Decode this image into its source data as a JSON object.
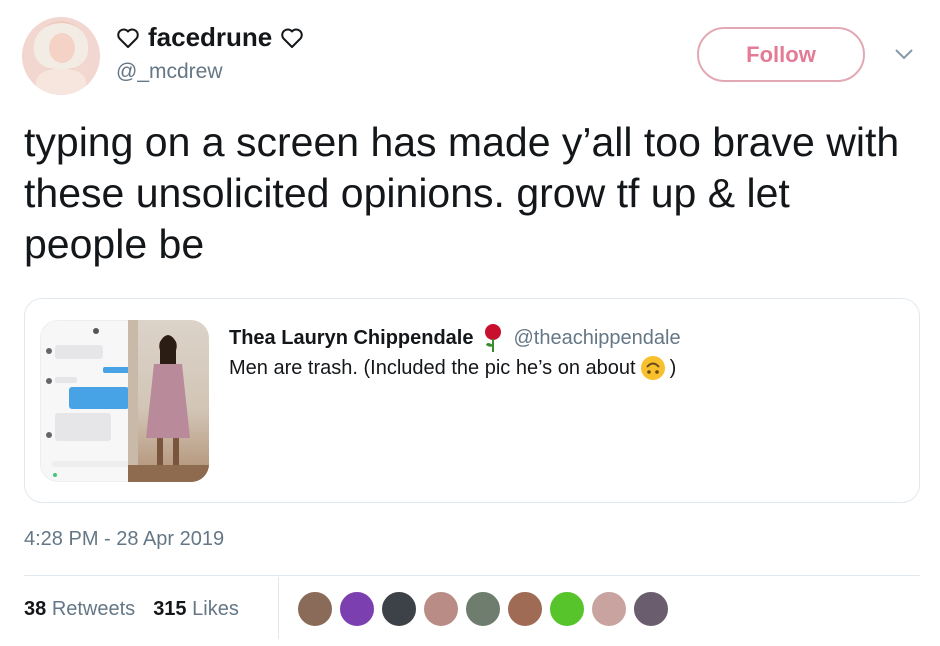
{
  "author": {
    "display_name": "facedrune",
    "handle": "@_mcdrew",
    "name_decoration_icon": "heart-outline-icon"
  },
  "follow_button": {
    "label": "Follow",
    "accent_color": "#e37b96"
  },
  "tweet": {
    "text": "typing on a screen has made y’all too brave with these unsolicited opinions. grow tf up & let people be"
  },
  "quoted_tweet": {
    "display_name": "Thea Lauryn Chippendale",
    "badge_icon": "rose-emoji-icon",
    "handle": "@theachippendale",
    "text": "Men are trash. (Included the pic he’s on about",
    "text_emoji": "upside-down-face-emoji-icon",
    "text_end": ")"
  },
  "timestamp": "4:28 PM - 28 Apr 2019",
  "stats": {
    "retweets_count": "38",
    "retweets_label": "Retweets",
    "likes_count": "315",
    "likes_label": "Likes"
  },
  "likers": [
    {
      "name": "liker-1",
      "color": "#8a6a58"
    },
    {
      "name": "liker-2",
      "color": "#7b3fb0"
    },
    {
      "name": "liker-3",
      "color": "#3d4148"
    },
    {
      "name": "liker-4",
      "color": "#b98d86"
    },
    {
      "name": "liker-5",
      "color": "#6f7d6e"
    },
    {
      "name": "liker-6",
      "color": "#a06b54"
    },
    {
      "name": "liker-7",
      "color": "#57c42c"
    },
    {
      "name": "liker-8",
      "color": "#c9a39f"
    },
    {
      "name": "liker-9",
      "color": "#6a5e6e"
    }
  ]
}
